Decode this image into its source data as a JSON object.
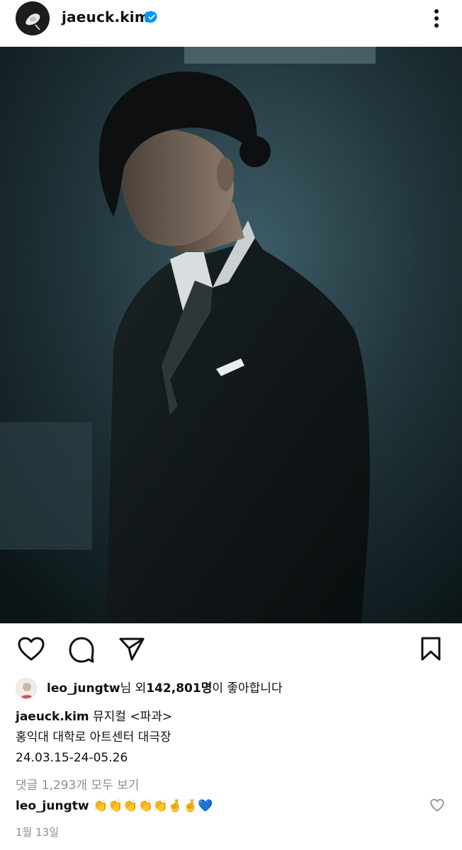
{
  "header": {
    "username": "jaeuck.kim",
    "verified_icon": "verified-badge-icon",
    "more_icon": "more-vertical-icon"
  },
  "post": {
    "image_alt": "Photo"
  },
  "actions": {
    "like_icon": "heart-icon",
    "comment_icon": "comment-icon",
    "share_icon": "send-icon",
    "save_icon": "bookmark-icon"
  },
  "likes": {
    "liker": "leo_jungtw",
    "suffix": "님 외 ",
    "count": "142,801명",
    "tail": "이 좋아합니다"
  },
  "caption": {
    "username": "jaeuck.kim",
    "line1": " 뮤지컬 <파과>",
    "line2": "홍익대 대학로 아트센터 대극장",
    "line3": "24.03.15-24-05.26"
  },
  "comments": {
    "view_all": "댓글 1,293개 모두 보기",
    "top_comment": {
      "username": "leo_jungtw",
      "text": "👏👏👏👏👏🤞🤞💙"
    }
  },
  "date": "1월 13일",
  "colors": {
    "verified_blue": "#0095f6",
    "muted_gray": "#8e8e8e"
  }
}
